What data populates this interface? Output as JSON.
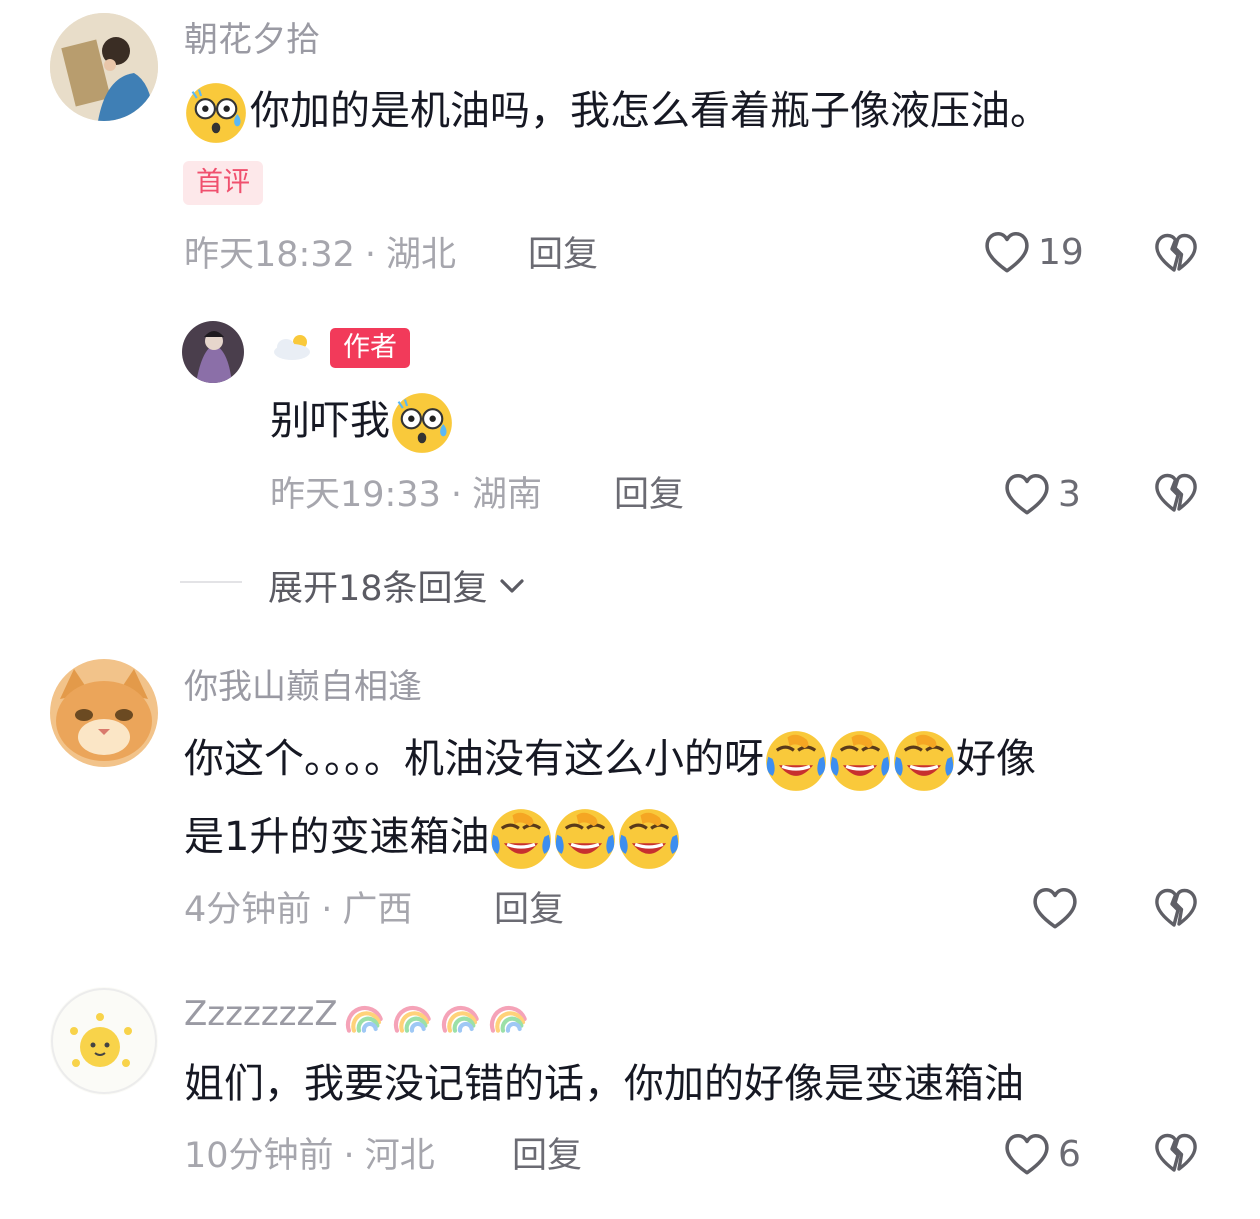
{
  "comments": [
    {
      "username": "朝花夕拾",
      "text": "你加的是机油吗，我怎么看着瓶子像液压油。",
      "badge": "首评",
      "time": "昨天18:32",
      "location": "湖北",
      "reply_label": "回复",
      "likes": "19",
      "reply": {
        "username_icon": "cloud-sun-icon",
        "author_badge": "作者",
        "text": "别吓我",
        "time": "昨天19:33",
        "location": "湖南",
        "reply_label": "回复",
        "likes": "3"
      },
      "expand_label": "展开18条回复"
    },
    {
      "username": "你我山巅自相逢",
      "text_line1": "你这个。。。。机油没有这么小的呀",
      "text_line1_tail": "好像",
      "text_line2": "是1升的变速箱油",
      "time": "4分钟前",
      "location": "广西",
      "reply_label": "回复",
      "likes": ""
    },
    {
      "username": "ZzzzzzzZ",
      "text": "姐们，我要没记错的话，你加的好像是变速箱油",
      "time": "10分钟前",
      "location": "河北",
      "reply_label": "回复",
      "likes": "6"
    }
  ],
  "separator": "·",
  "colors": {
    "author_badge": "#f23a5a",
    "first_badge_bg": "#fde8ea",
    "first_badge_text": "#f0506e",
    "meta_text": "#a6a6ad"
  }
}
